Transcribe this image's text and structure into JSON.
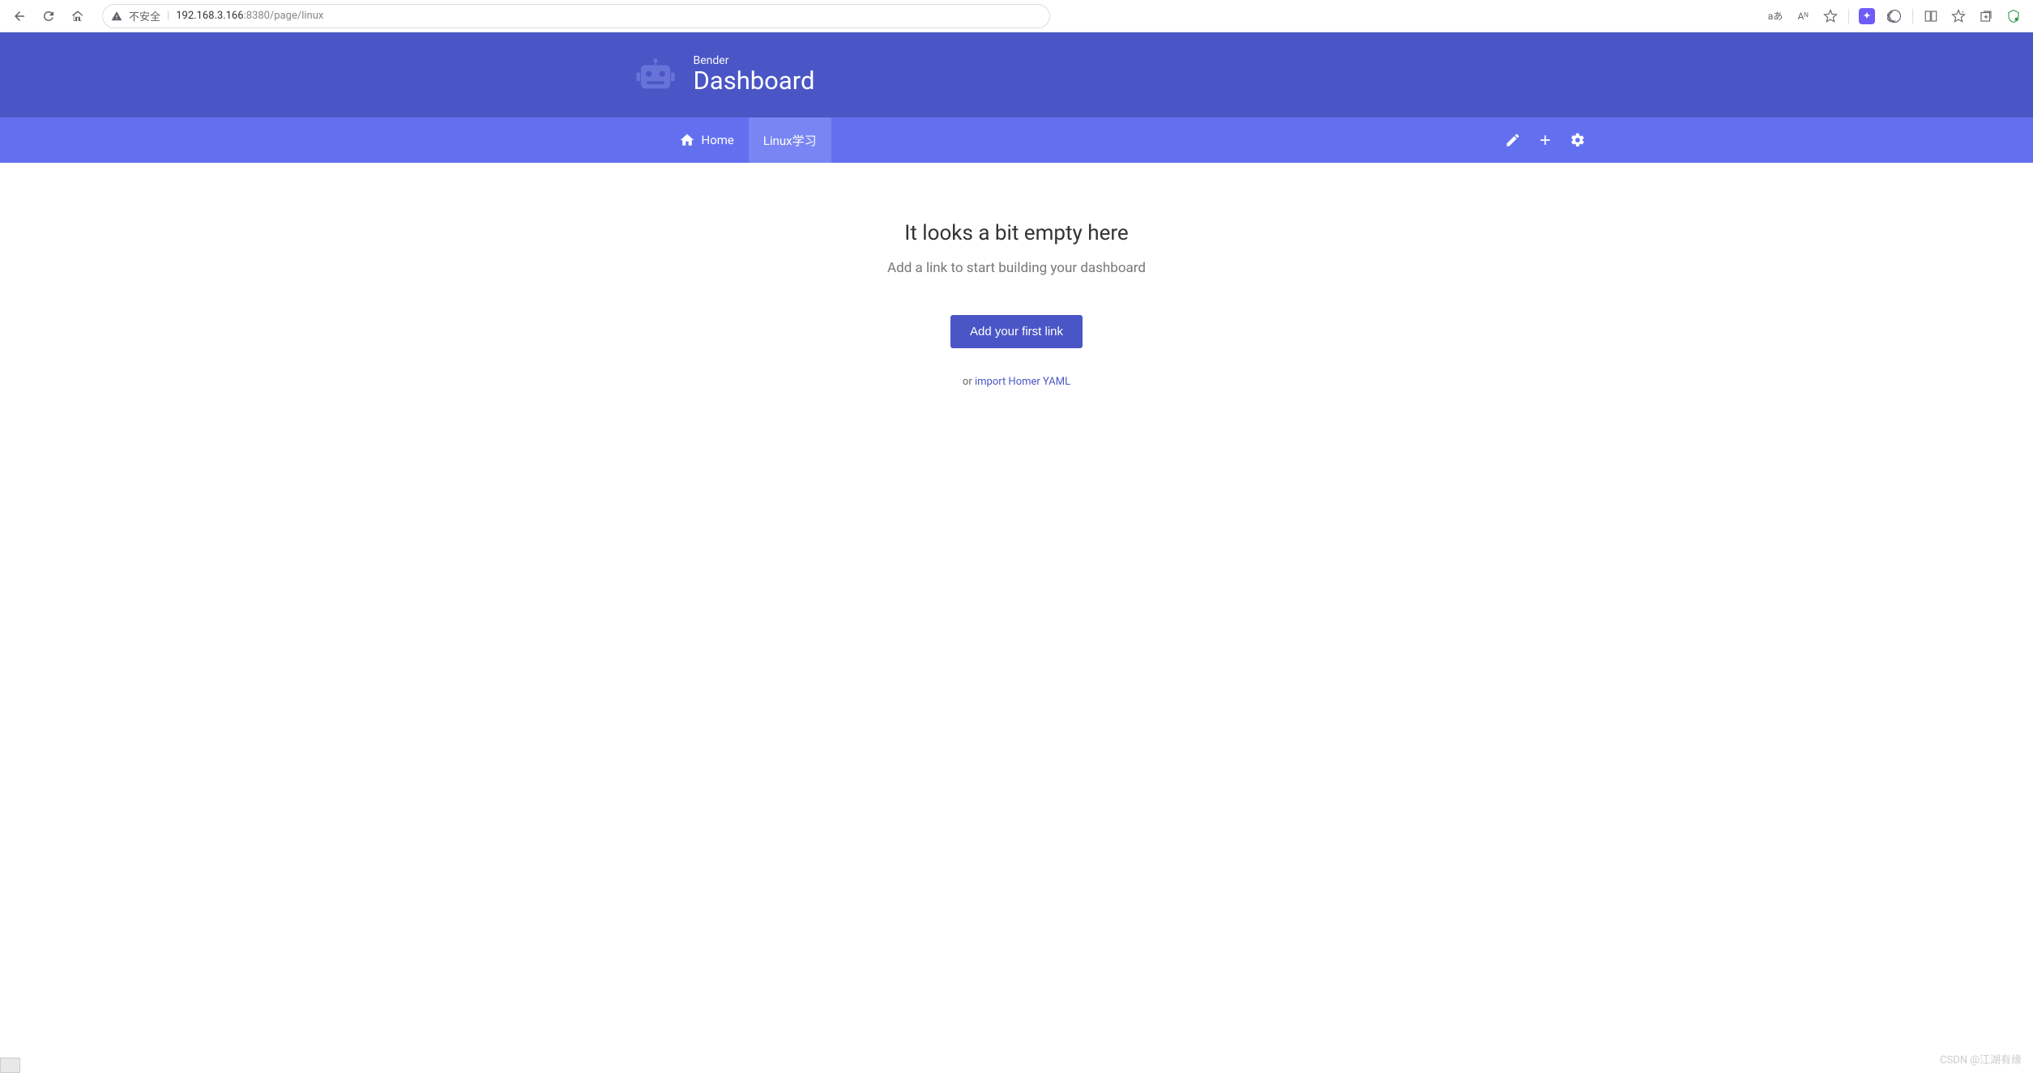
{
  "browser": {
    "security_label": "不安全",
    "url_host": "192.168.3.166",
    "url_rest": ":8380/page/linux",
    "translate_label": "aあ",
    "read_aloud_label": "Aᴺ"
  },
  "header": {
    "subtitle": "Bender",
    "title": "Dashboard"
  },
  "nav": {
    "home_label": "Home",
    "linux_label": "Linux学习"
  },
  "empty": {
    "title": "It looks a bit empty here",
    "subtitle": "Add a link to start building your dashboard",
    "button": "Add your first link",
    "or_prefix": "or ",
    "import_link": "import Homer YAML"
  },
  "watermark": "CSDN @江湖有缘"
}
